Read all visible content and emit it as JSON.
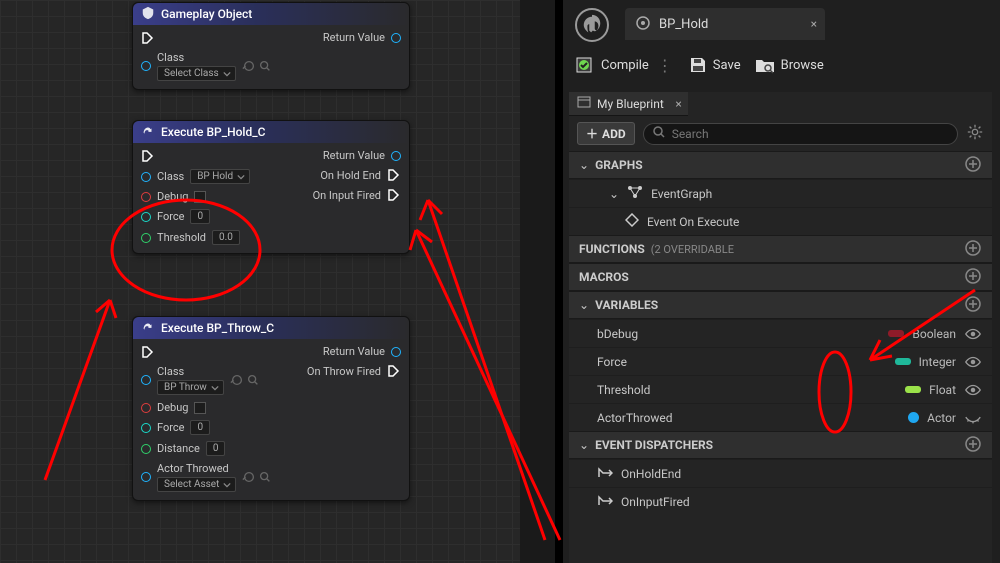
{
  "nodes": {
    "gameplay": {
      "title": "Gameplay Object",
      "class_label": "Class",
      "class_value": "Select Class",
      "return_label": "Return Value"
    },
    "hold": {
      "title": "Execute BP_Hold_C",
      "class_label": "Class",
      "class_value": "BP Hold",
      "debug_label": "Debug",
      "force_label": "Force",
      "force_value": "0",
      "threshold_label": "Threshold",
      "threshold_value": "0.0",
      "return_label": "Return Value",
      "on_hold_end": "On Hold End",
      "on_input_fired": "On Input Fired"
    },
    "throw": {
      "title": "Execute BP_Throw_C",
      "class_label": "Class",
      "class_value": "BP Throw",
      "debug_label": "Debug",
      "force_label": "Force",
      "force_value": "0",
      "distance_label": "Distance",
      "distance_value": "0",
      "actor_label": "Actor Throwed",
      "actor_value": "Select Asset",
      "return_label": "Return Value",
      "on_throw_fired": "On Throw Fired"
    }
  },
  "editor": {
    "main_tab": "BP_Hold",
    "toolbar": {
      "compile": "Compile",
      "save": "Save",
      "browse": "Browse"
    },
    "my_blueprint": {
      "tab": "My Blueprint",
      "add": "ADD",
      "search_placeholder": "Search",
      "sections": {
        "graphs": "GRAPHS",
        "event_graph": "EventGraph",
        "event_on_execute": "Event On Execute",
        "functions": "FUNCTIONS",
        "functions_sub": "(2 OVERRIDABLE",
        "macros": "MACROS",
        "variables": "VARIABLES",
        "dispatchers": "EVENT DISPATCHERS"
      },
      "vars": [
        {
          "name": "bDebug",
          "type": "Boolean",
          "color": "#8e1b29",
          "shape": "pill",
          "eye": "open"
        },
        {
          "name": "Force",
          "type": "Integer",
          "color": "#1fb89a",
          "shape": "pill",
          "eye": "open"
        },
        {
          "name": "Threshold",
          "type": "Float",
          "color": "#9be24a",
          "shape": "pill",
          "eye": "open"
        },
        {
          "name": "ActorThrowed",
          "type": "Actor",
          "color": "#1fa7f0",
          "shape": "circle",
          "eye": "closed"
        }
      ],
      "dispatchers": [
        {
          "name": "OnHoldEnd"
        },
        {
          "name": "OnInputFired"
        }
      ]
    }
  }
}
